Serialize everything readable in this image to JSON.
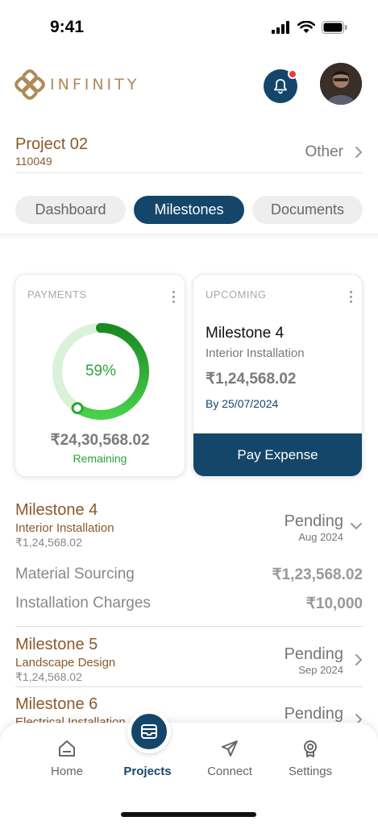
{
  "status_bar": {
    "time": "9:41"
  },
  "brand": {
    "name": "INFINITY",
    "accent": "#b08a5a"
  },
  "colors": {
    "primary": "#14466a",
    "success": "#2ba43a",
    "brown": "#8a5a2b",
    "badge": "#ef3b3b"
  },
  "header": {
    "bell_icon": "bell-icon",
    "avatar_icon": "user-avatar"
  },
  "project": {
    "name": "Project 02",
    "code": "110049",
    "other_label": "Other"
  },
  "tabs": [
    {
      "label": "Dashboard",
      "active": false
    },
    {
      "label": "Milestones",
      "active": true
    },
    {
      "label": "Documents",
      "active": false
    }
  ],
  "payments_card": {
    "title": "PAYMENTS",
    "percent_label": "59%",
    "progress_fraction": 0.59,
    "amount": "₹24,30,568.02",
    "remaining_label": "Remaining"
  },
  "upcoming_card": {
    "title": "UPCOMING",
    "milestone": "Milestone 4",
    "subtitle": "Interior Installation",
    "amount": "₹1,24,568.02",
    "due": "By 25/07/2024",
    "button_label": "Pay Expense"
  },
  "milestones": [
    {
      "name": "Milestone 4",
      "subtitle": "Interior Installation",
      "amount": "₹1,24,568.02",
      "status": "Pending",
      "date": "Aug 2024",
      "expanded": true,
      "details": [
        {
          "label": "Material Sourcing",
          "value": "₹1,23,568.02"
        },
        {
          "label": "Installation Charges",
          "value": "₹10,000"
        }
      ]
    },
    {
      "name": "Milestone 5",
      "subtitle": "Landscape Design",
      "amount": "₹1,24,568.02",
      "status": "Pending",
      "date": "Sep 2024",
      "expanded": false
    },
    {
      "name": "Milestone 6",
      "subtitle": "Electrical Installation",
      "status": "Pending",
      "expanded": false
    }
  ],
  "bottom_nav": {
    "items": [
      {
        "label": "Home",
        "icon": "home-icon",
        "active": false
      },
      {
        "label": "Projects",
        "icon": "projects-icon",
        "active": true
      },
      {
        "label": "Connect",
        "icon": "send-icon",
        "active": false
      },
      {
        "label": "Settings",
        "icon": "settings-icon",
        "active": false
      }
    ]
  }
}
